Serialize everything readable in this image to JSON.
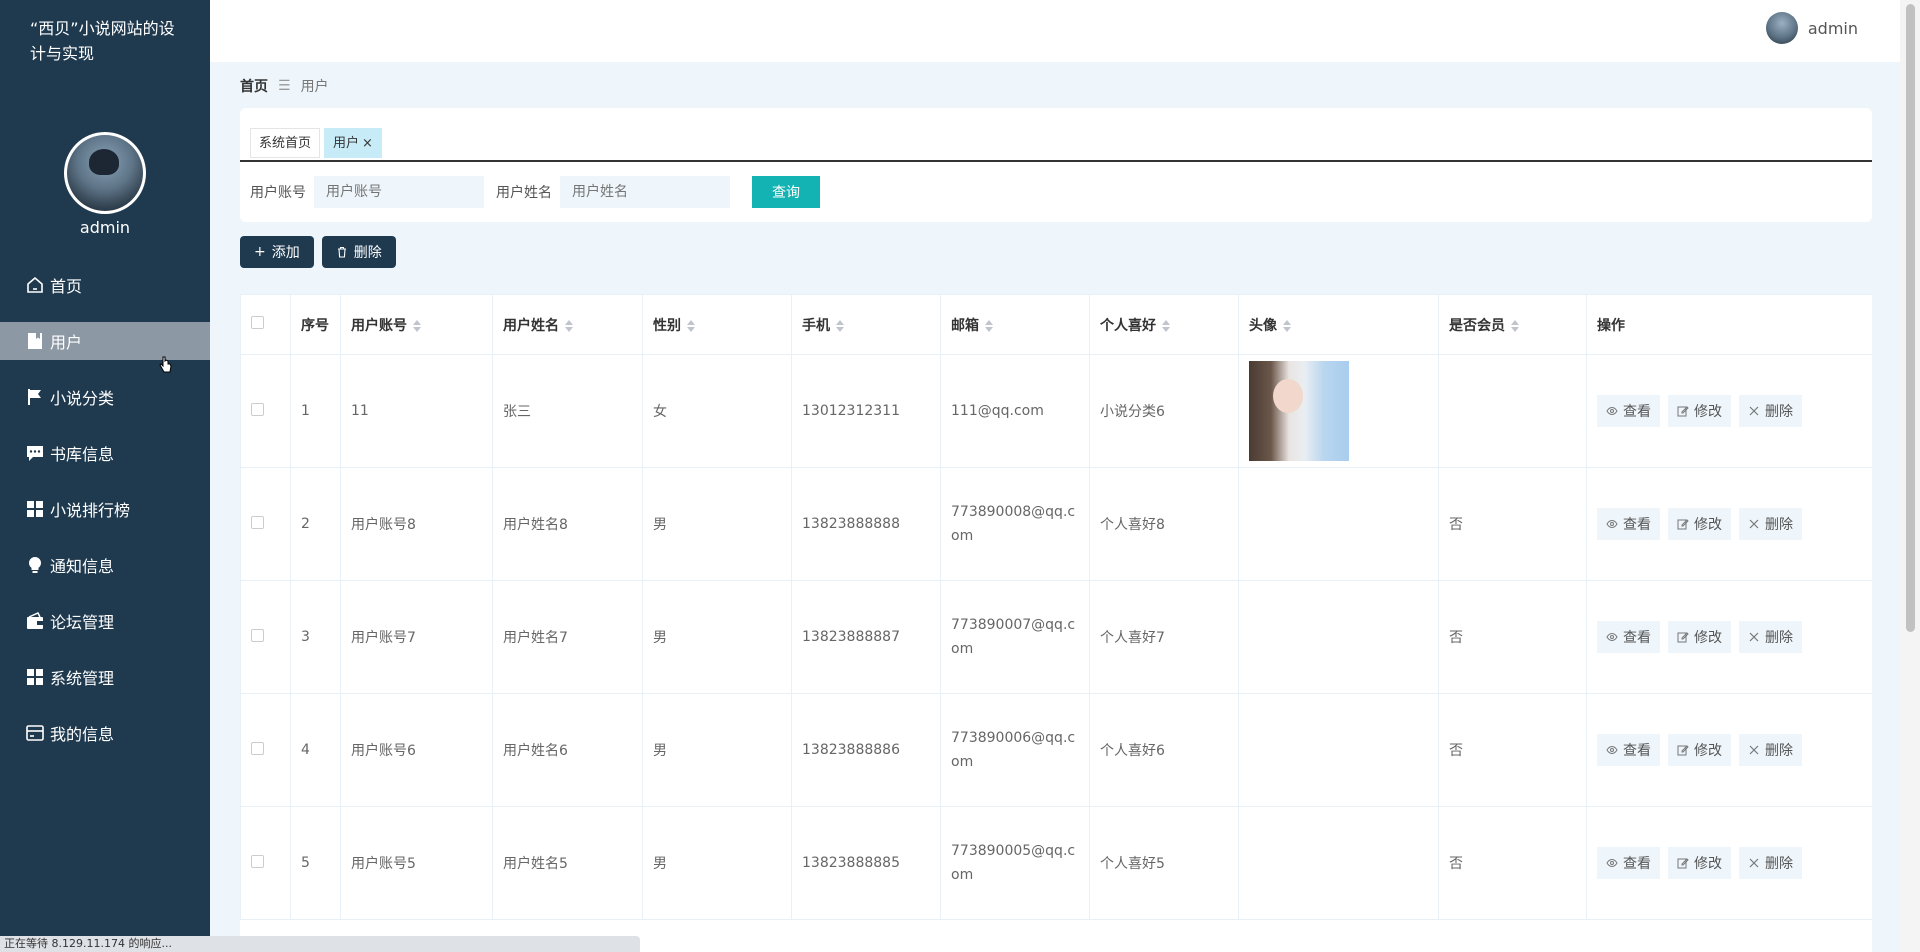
{
  "brand": "“西贝”小说网站的设计与实现",
  "sidebar": {
    "username": "admin",
    "items": [
      {
        "label": "首页",
        "icon": "home-icon",
        "active": false
      },
      {
        "label": "用户",
        "icon": "bookmark-icon",
        "active": true
      },
      {
        "label": "小说分类",
        "icon": "flag-icon",
        "active": false
      },
      {
        "label": "书库信息",
        "icon": "chat-icon",
        "active": false
      },
      {
        "label": "小说排行榜",
        "icon": "grid-icon",
        "active": false
      },
      {
        "label": "通知信息",
        "icon": "bulb-icon",
        "active": false
      },
      {
        "label": "论坛管理",
        "icon": "wallet-icon",
        "active": false
      },
      {
        "label": "系统管理",
        "icon": "grid-icon",
        "active": false
      },
      {
        "label": "我的信息",
        "icon": "card-icon",
        "active": false
      }
    ]
  },
  "header": {
    "username": "admin"
  },
  "breadcrumb": {
    "home": "首页",
    "separator": "☰",
    "current": "用户"
  },
  "tabs": [
    {
      "label": "系统首页",
      "active": false,
      "closable": false
    },
    {
      "label": "用户",
      "active": true,
      "closable": true
    }
  ],
  "search": {
    "account_label": "用户账号",
    "account_placeholder": "用户账号",
    "name_label": "用户姓名",
    "name_placeholder": "用户姓名",
    "button": "查询"
  },
  "actions": {
    "add": "添加",
    "delete": "删除"
  },
  "table": {
    "columns": [
      "序号",
      "用户账号",
      "用户姓名",
      "性别",
      "手机",
      "邮箱",
      "个人喜好",
      "头像",
      "是否会员",
      "操作"
    ],
    "rows": [
      {
        "index": "1",
        "account": "11",
        "name": "张三",
        "gender": "女",
        "phone": "13012312311",
        "email": "111@qq.com",
        "hobby": "小说分类6",
        "has_avatar": true,
        "member": ""
      },
      {
        "index": "2",
        "account": "用户账号8",
        "name": "用户姓名8",
        "gender": "男",
        "phone": "13823888888",
        "email": "773890008@qq.com",
        "hobby": "个人喜好8",
        "has_avatar": false,
        "member": "否"
      },
      {
        "index": "3",
        "account": "用户账号7",
        "name": "用户姓名7",
        "gender": "男",
        "phone": "13823888887",
        "email": "773890007@qq.com",
        "hobby": "个人喜好7",
        "has_avatar": false,
        "member": "否"
      },
      {
        "index": "4",
        "account": "用户账号6",
        "name": "用户姓名6",
        "gender": "男",
        "phone": "13823888886",
        "email": "773890006@qq.com",
        "hobby": "个人喜好6",
        "has_avatar": false,
        "member": "否"
      },
      {
        "index": "5",
        "account": "用户账号5",
        "name": "用户姓名5",
        "gender": "男",
        "phone": "13823888885",
        "email": "773890005@qq.com",
        "hobby": "个人喜好5",
        "has_avatar": false,
        "member": "否"
      }
    ],
    "ops": {
      "view": "查看",
      "edit": "修改",
      "delete": "删除"
    }
  },
  "statusbar": "正在等待 8.129.11.174 的响应...",
  "colors": {
    "sidebar": "#1f3a4f",
    "accent": "#13b3b3",
    "active_menu": "#8c98a3",
    "page_bg": "#eef6fc"
  }
}
